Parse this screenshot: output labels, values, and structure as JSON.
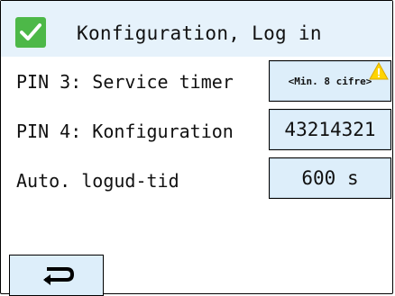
{
  "header": {
    "title": "Konfiguration, Log in",
    "icon": "check-icon",
    "icon_color": "#4db848",
    "background": "#e6f2fb"
  },
  "rows": [
    {
      "label": "PIN 3: Service timer",
      "value": "<Min. 8 cifre>",
      "warning": true
    },
    {
      "label": "PIN 4: Konfiguration",
      "value": "43214321"
    },
    {
      "label": "Auto. logud-tid",
      "value": "600 s"
    }
  ],
  "footer": {
    "back_icon": "return-arrow-icon"
  },
  "colors": {
    "field_bg": "#ddeefa",
    "warning": "#ffd400"
  }
}
